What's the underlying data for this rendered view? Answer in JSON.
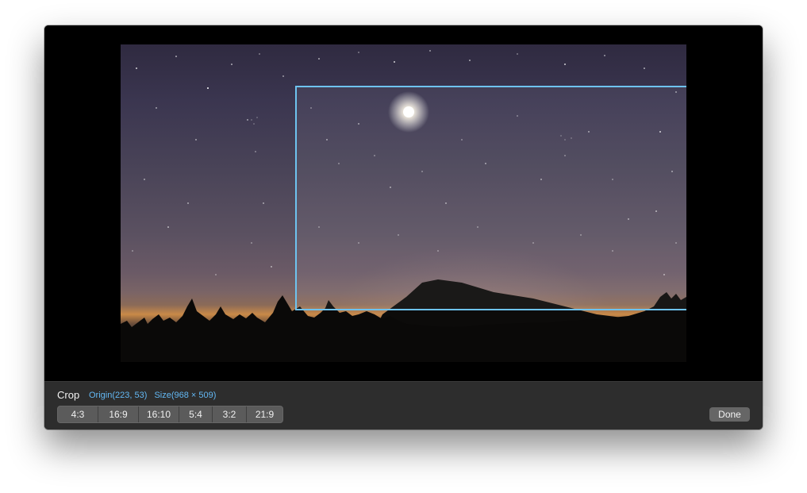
{
  "crop": {
    "title": "Crop",
    "origin": "Origin(223, 53)",
    "size": "Size(968 × 509)"
  },
  "ratios": [
    "4:3",
    "16:9",
    "16:10",
    "5:4",
    "3:2",
    "21:9"
  ],
  "done_label": "Done",
  "colors": {
    "accent": "#6ec3ef",
    "info_text": "#63b8f4",
    "toolbar_bg": "#2d2d2d",
    "button_bg": "#5b5b5b"
  }
}
